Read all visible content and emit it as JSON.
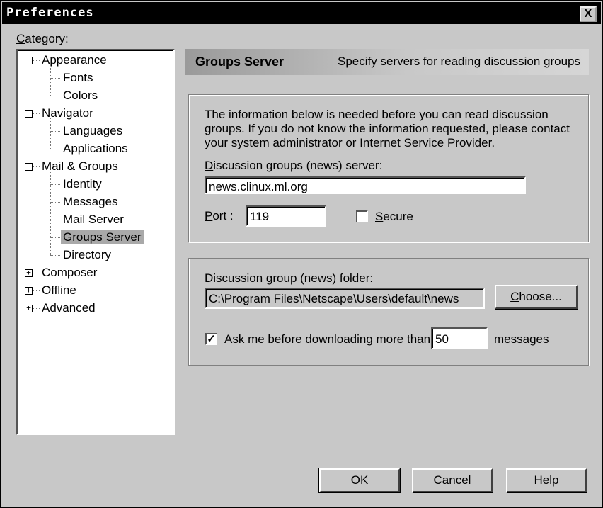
{
  "window": {
    "title": "Preferences",
    "close_glyph": "X"
  },
  "category_label": {
    "prefix": "C",
    "rest": "ategory:"
  },
  "tree": [
    {
      "label": "Appearance",
      "level": 0,
      "expander": "−"
    },
    {
      "label": "Fonts",
      "level": 1
    },
    {
      "label": "Colors",
      "level": 1
    },
    {
      "label": "Navigator",
      "level": 0,
      "expander": "−"
    },
    {
      "label": "Languages",
      "level": 1
    },
    {
      "label": "Applications",
      "level": 1
    },
    {
      "label": "Mail & Groups",
      "level": 0,
      "expander": "−"
    },
    {
      "label": "Identity",
      "level": 1
    },
    {
      "label": "Messages",
      "level": 1
    },
    {
      "label": "Mail Server",
      "level": 1
    },
    {
      "label": "Groups Server",
      "level": 1,
      "selected": true
    },
    {
      "label": "Directory",
      "level": 1
    },
    {
      "label": "Composer",
      "level": 0,
      "expander": "+"
    },
    {
      "label": "Offline",
      "level": 0,
      "expander": "+"
    },
    {
      "label": "Advanced",
      "level": 0,
      "expander": "+"
    }
  ],
  "header": {
    "title": "Groups Server",
    "description": "Specify servers for reading discussion groups"
  },
  "server_group": {
    "info_line1": "The information below is needed before you can read discussion",
    "info_line2": "groups.  If you do not know the information requested, please contact",
    "info_line3": "your system administrator or Internet Service Provider.",
    "server_label_prefix": "D",
    "server_label_rest": "iscussion groups (news) server:",
    "server_value": "news.clinux.ml.org",
    "port_label_prefix": "P",
    "port_label_rest": "ort :",
    "port_value": "119",
    "secure_label_prefix": "S",
    "secure_label_rest": "ecure",
    "secure_checked": false
  },
  "folder_group": {
    "folder_label": "Discussion group (news) folder:",
    "folder_value": "C:\\Program Files\\Netscape\\Users\\default\\news",
    "choose_prefix": "C",
    "choose_rest": "hoose...",
    "ask_prefix": "A",
    "ask_rest": "sk me before downloading more than",
    "ask_checked": true,
    "check_glyph": "✓",
    "messages_value": "50",
    "messages_prefix": "m",
    "messages_rest": "essages"
  },
  "buttons": {
    "ok": "OK",
    "cancel": "Cancel",
    "help_prefix": "H",
    "help_rest": "elp"
  }
}
